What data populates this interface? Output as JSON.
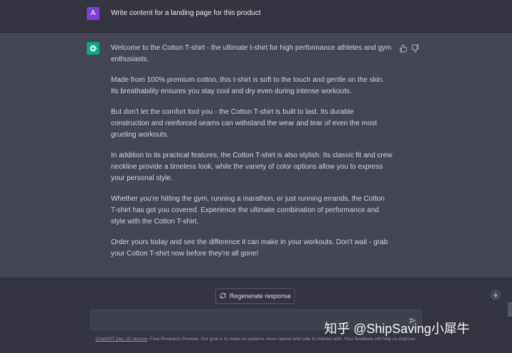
{
  "user_message": {
    "avatar_letter": "A",
    "text": "Write content for a landing page for this product"
  },
  "assistant_message": {
    "paragraphs": [
      "Welcome to the Cotton T-shirt - the ultimate t-shirt for high performance athletes and gym enthusiasts.",
      "Made from 100% premium cotton, this t-shirt is soft to the touch and gentle on the skin. Its breathability ensures you stay cool and dry even during intense workouts.",
      "But don't let the comfort fool you - the Cotton T-shirt is built to last. Its durable construction and reinforced seams can withstand the wear and tear of even the most grueling workouts.",
      "In addition to its practical features, the Cotton T-shirt is also stylish. Its classic fit and crew neckline provide a timeless look, while the variety of color options allow you to express your personal style.",
      "Whether you're hitting the gym, running a marathon, or just running errands, the Cotton T-shirt has got you covered. Experience the ultimate combination of performance and style with the Cotton T-shirt.",
      "Order yours today and see the difference it can make in your workouts. Don't wait - grab your Cotton T-shirt now before they're all gone!"
    ]
  },
  "controls": {
    "regenerate_label": "Regenerate response",
    "input_value": "",
    "input_placeholder": ""
  },
  "footer": {
    "link_text": "ChatGPT Dec 15 Version",
    "text": ". Free Research Preview. Our goal is to make AI systems more natural and safe to interact with. Your feedback will help us improve."
  },
  "watermark": {
    "text": "知乎 @ShipSaving小犀牛"
  },
  "colors": {
    "background": "#343541",
    "assistant_background": "#444654",
    "user_avatar": "#7b3ee0",
    "bot_avatar": "#10a37f",
    "input_background": "#40414f"
  },
  "icons": {
    "bot_avatar": "openai-logo-icon",
    "thumbs_up": "thumbs-up-icon",
    "thumbs_down": "thumbs-down-icon",
    "regenerate": "refresh-icon",
    "scroll_down": "arrow-down-icon",
    "send": "send-icon"
  }
}
